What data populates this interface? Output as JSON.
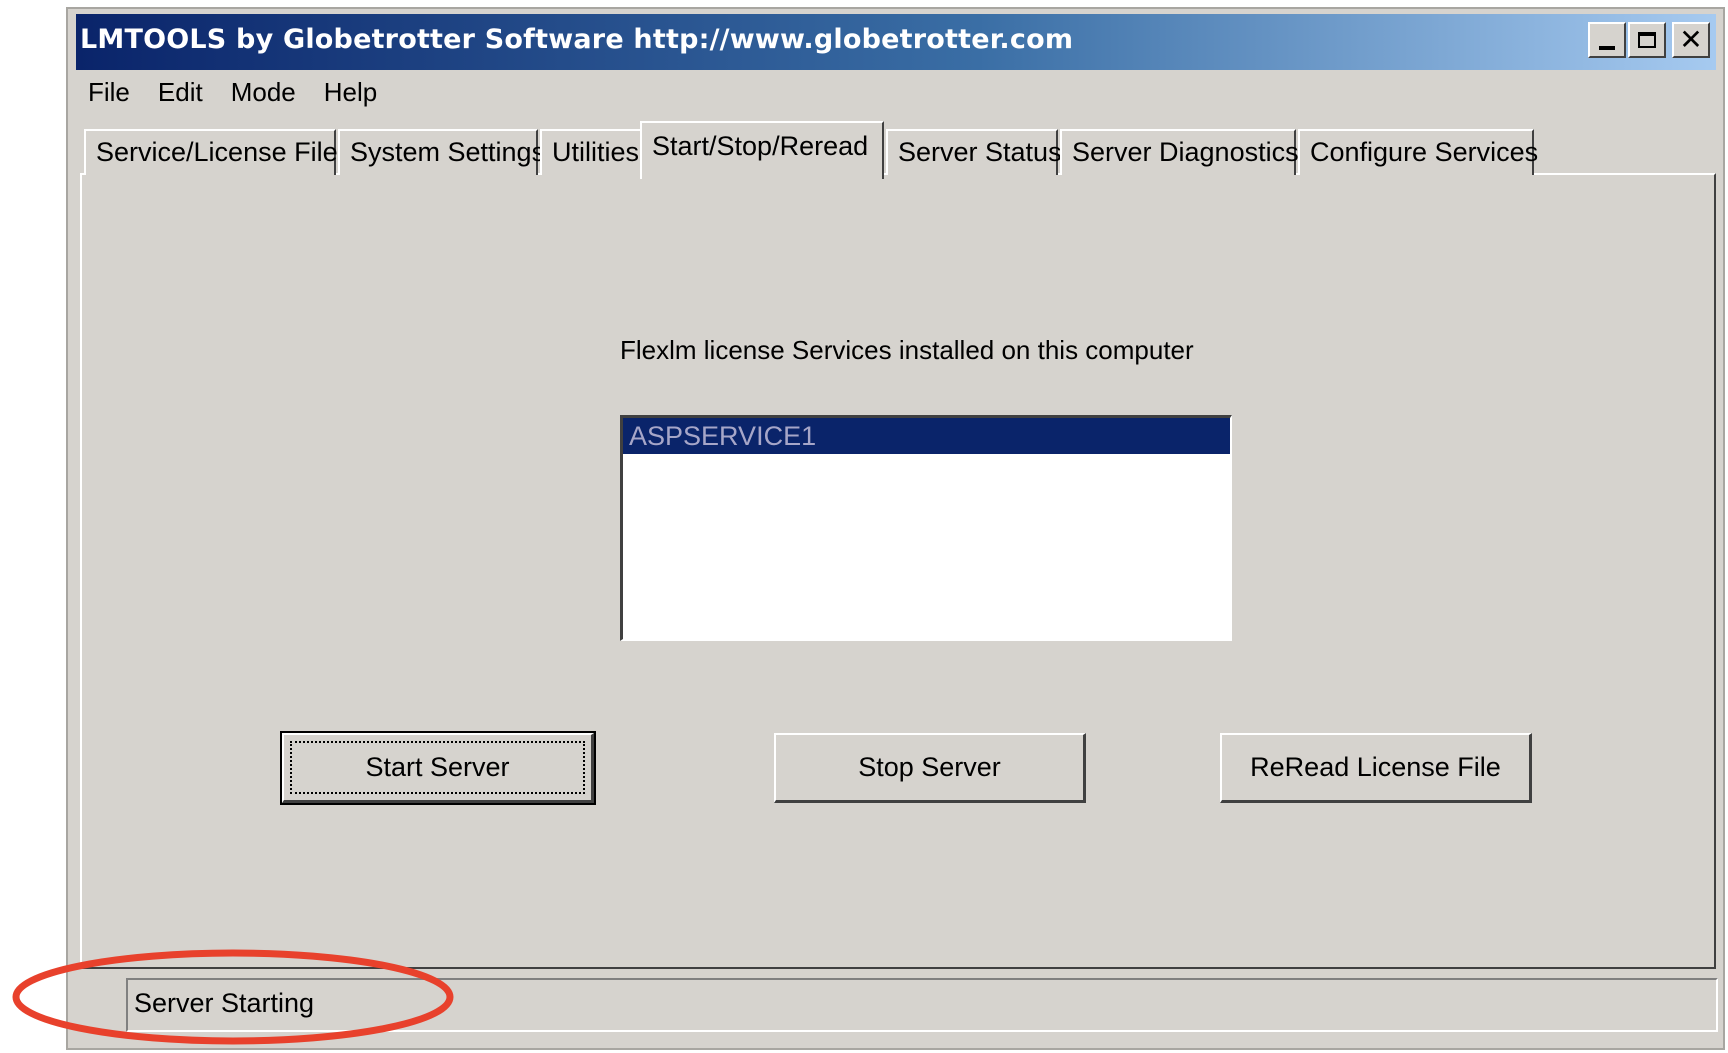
{
  "window": {
    "title": "LMTOOLS by Globetrotter Software http://www.globetrotter.com"
  },
  "menu": [
    "File",
    "Edit",
    "Mode",
    "Help"
  ],
  "tabs": [
    {
      "label": "Service/License File"
    },
    {
      "label": "System Settings"
    },
    {
      "label": "Utilities"
    },
    {
      "label": "Start/Stop/Reread"
    },
    {
      "label": "Server Status"
    },
    {
      "label": "Server Diagnostics"
    },
    {
      "label": "Configure Services"
    }
  ],
  "active_tab": "Start/Stop/Reread",
  "main": {
    "services_label": "Flexlm license Services installed on this computer",
    "services": [
      "ASPSERVICE1"
    ],
    "selected_service": "ASPSERVICE1",
    "buttons": {
      "start": "Start Server",
      "stop": "Stop Server",
      "reread": "ReRead License File"
    }
  },
  "status": {
    "text": "Server Starting"
  },
  "annotation": {
    "color": "#e8412c"
  },
  "colors": {
    "titlebar_start": "#0a246a",
    "titlebar_end": "#a6caf0",
    "face": "#d6d3ce",
    "selection": "#0a246a"
  }
}
